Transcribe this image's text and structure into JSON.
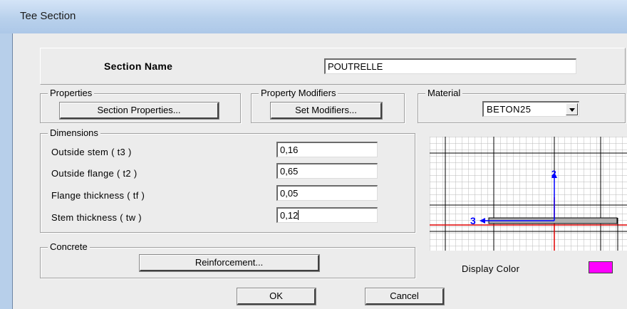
{
  "window": {
    "title": "Tee Section"
  },
  "section_name": {
    "label": "Section Name",
    "value": "POUTRELLE"
  },
  "properties": {
    "label": "Properties",
    "button": "Section Properties..."
  },
  "property_modifiers": {
    "label": "Property Modifiers",
    "button": "Set Modifiers..."
  },
  "material": {
    "label": "Material",
    "selected": "BETON25"
  },
  "dimensions": {
    "label": "Dimensions",
    "fields": [
      {
        "label": "Outside stem  ( t3 )",
        "value": "0,16"
      },
      {
        "label": "Outside flange  ( t2 )",
        "value": "0,65"
      },
      {
        "label": "Flange thickness  ( tf )",
        "value": "0,05"
      },
      {
        "label": "Stem thickness  ( tw )",
        "value": "0,12"
      }
    ]
  },
  "concrete": {
    "label": "Concrete",
    "button": "Reinforcement..."
  },
  "preview": {
    "axis_3_label": "3",
    "axis_2_label": "2"
  },
  "display_color": {
    "label": "Display Color",
    "color": "#ff00ff"
  },
  "actions": {
    "ok": "OK",
    "cancel": "Cancel"
  }
}
